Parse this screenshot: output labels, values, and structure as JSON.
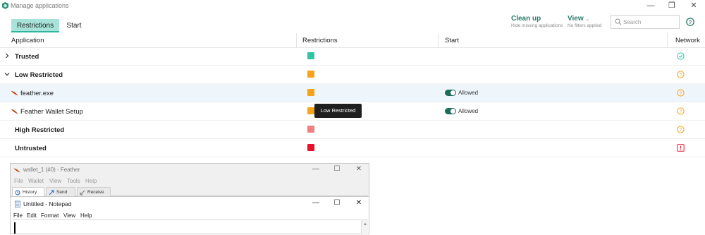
{
  "window": {
    "title": "Manage applications",
    "minimize": "—",
    "maximize": "❐",
    "close": "✕"
  },
  "tabs": [
    {
      "label": "Restrictions",
      "active": true
    },
    {
      "label": "Start",
      "active": false
    }
  ],
  "toolbar": {
    "cleanup_label": "Clean up",
    "cleanup_sub": "Hide missing applications",
    "view_label": "View",
    "view_sub": "No filters applied",
    "search_placeholder": "Search"
  },
  "columns": {
    "application": "Application",
    "restrictions": "Restrictions",
    "start": "Start",
    "network": "Network"
  },
  "rows": [
    {
      "name": "Trusted",
      "expand": "collapsed",
      "restriction_color": "#2ec4a4",
      "network": "check"
    },
    {
      "name": "Low Restricted",
      "expand": "expanded",
      "restriction_color": "#f7a21b",
      "network": "question"
    },
    {
      "name": "feather.exe",
      "child": true,
      "restriction_color": "#f7a21b",
      "start": "Allowed",
      "network": "question"
    },
    {
      "name": "Feather Wallet Setup",
      "child": true,
      "restriction_color": "#f7a21b",
      "start": "Allowed",
      "network": "question"
    },
    {
      "name": "High Restricted",
      "restriction_color": "#f08080",
      "network": "question"
    },
    {
      "name": "Untrusted",
      "restriction_color": "#e8102c",
      "network": "blocked"
    }
  ],
  "tooltip": "Low Restricted",
  "feather_window": {
    "title": "wallet_1 (#0) - Feather",
    "menu": [
      "File",
      "Wallet",
      "View",
      "Tools",
      "Help"
    ],
    "tabs": [
      "History",
      "Send",
      "Receive"
    ],
    "minimize": "—",
    "maximize": "☐",
    "close": "✕"
  },
  "notepad": {
    "title": "Untitled - Notepad",
    "menu": [
      "File",
      "Edit",
      "Format",
      "View",
      "Help"
    ],
    "minimize": "—",
    "maximize": "☐",
    "close": "✕",
    "scroll_up": "▲"
  },
  "colors": {
    "accent": "#2b7a67",
    "tab_active_bg": "#a7e3d9",
    "toggle_on": "#1c6b5b",
    "net_ok": "#2ec4a4",
    "net_warn": "#f7a21b",
    "net_block": "#e8102c"
  }
}
